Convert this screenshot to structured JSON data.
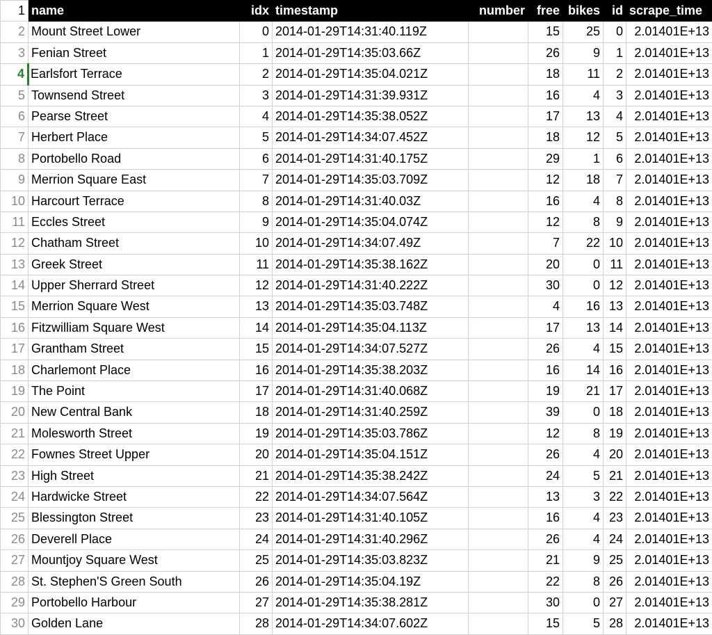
{
  "header": {
    "rownum": "1",
    "columns": {
      "name": "name",
      "idx": "idx",
      "timestamp": "timestamp",
      "number": "number",
      "free": "free",
      "bikes": "bikes",
      "id": "id",
      "scrape_time": "scrape_time"
    }
  },
  "selected_row": 4,
  "rows": [
    {
      "rownum": "2",
      "name": "Mount Street Lower",
      "idx": "0",
      "timestamp": "2014-01-29T14:31:40.119Z",
      "number": "",
      "free": "15",
      "bikes": "25",
      "id": "0",
      "scrape_time": "2.01401E+13"
    },
    {
      "rownum": "3",
      "name": "Fenian Street",
      "idx": "1",
      "timestamp": "2014-01-29T14:35:03.66Z",
      "number": "",
      "free": "26",
      "bikes": "9",
      "id": "1",
      "scrape_time": "2.01401E+13"
    },
    {
      "rownum": "4",
      "name": "Earlsfort Terrace",
      "idx": "2",
      "timestamp": "2014-01-29T14:35:04.021Z",
      "number": "",
      "free": "18",
      "bikes": "11",
      "id": "2",
      "scrape_time": "2.01401E+13"
    },
    {
      "rownum": "5",
      "name": "Townsend Street",
      "idx": "3",
      "timestamp": "2014-01-29T14:31:39.931Z",
      "number": "",
      "free": "16",
      "bikes": "4",
      "id": "3",
      "scrape_time": "2.01401E+13"
    },
    {
      "rownum": "6",
      "name": "Pearse Street",
      "idx": "4",
      "timestamp": "2014-01-29T14:35:38.052Z",
      "number": "",
      "free": "17",
      "bikes": "13",
      "id": "4",
      "scrape_time": "2.01401E+13"
    },
    {
      "rownum": "7",
      "name": "Herbert Place",
      "idx": "5",
      "timestamp": "2014-01-29T14:34:07.452Z",
      "number": "",
      "free": "18",
      "bikes": "12",
      "id": "5",
      "scrape_time": "2.01401E+13"
    },
    {
      "rownum": "8",
      "name": "Portobello Road",
      "idx": "6",
      "timestamp": "2014-01-29T14:31:40.175Z",
      "number": "",
      "free": "29",
      "bikes": "1",
      "id": "6",
      "scrape_time": "2.01401E+13"
    },
    {
      "rownum": "9",
      "name": "Merrion Square East",
      "idx": "7",
      "timestamp": "2014-01-29T14:35:03.709Z",
      "number": "",
      "free": "12",
      "bikes": "18",
      "id": "7",
      "scrape_time": "2.01401E+13"
    },
    {
      "rownum": "10",
      "name": "Harcourt Terrace",
      "idx": "8",
      "timestamp": "2014-01-29T14:31:40.03Z",
      "number": "",
      "free": "16",
      "bikes": "4",
      "id": "8",
      "scrape_time": "2.01401E+13"
    },
    {
      "rownum": "11",
      "name": "Eccles Street",
      "idx": "9",
      "timestamp": "2014-01-29T14:35:04.074Z",
      "number": "",
      "free": "12",
      "bikes": "8",
      "id": "9",
      "scrape_time": "2.01401E+13"
    },
    {
      "rownum": "12",
      "name": "Chatham Street",
      "idx": "10",
      "timestamp": "2014-01-29T14:34:07.49Z",
      "number": "",
      "free": "7",
      "bikes": "22",
      "id": "10",
      "scrape_time": "2.01401E+13"
    },
    {
      "rownum": "13",
      "name": "Greek Street",
      "idx": "11",
      "timestamp": "2014-01-29T14:35:38.162Z",
      "number": "",
      "free": "20",
      "bikes": "0",
      "id": "11",
      "scrape_time": "2.01401E+13"
    },
    {
      "rownum": "14",
      "name": "Upper Sherrard Street",
      "idx": "12",
      "timestamp": "2014-01-29T14:31:40.222Z",
      "number": "",
      "free": "30",
      "bikes": "0",
      "id": "12",
      "scrape_time": "2.01401E+13"
    },
    {
      "rownum": "15",
      "name": "Merrion Square West",
      "idx": "13",
      "timestamp": "2014-01-29T14:35:03.748Z",
      "number": "",
      "free": "4",
      "bikes": "16",
      "id": "13",
      "scrape_time": "2.01401E+13"
    },
    {
      "rownum": "16",
      "name": "Fitzwilliam Square West",
      "idx": "14",
      "timestamp": "2014-01-29T14:35:04.113Z",
      "number": "",
      "free": "17",
      "bikes": "13",
      "id": "14",
      "scrape_time": "2.01401E+13"
    },
    {
      "rownum": "17",
      "name": "Grantham Street",
      "idx": "15",
      "timestamp": "2014-01-29T14:34:07.527Z",
      "number": "",
      "free": "26",
      "bikes": "4",
      "id": "15",
      "scrape_time": "2.01401E+13"
    },
    {
      "rownum": "18",
      "name": "Charlemont Place",
      "idx": "16",
      "timestamp": "2014-01-29T14:35:38.203Z",
      "number": "",
      "free": "16",
      "bikes": "14",
      "id": "16",
      "scrape_time": "2.01401E+13"
    },
    {
      "rownum": "19",
      "name": "The Point",
      "idx": "17",
      "timestamp": "2014-01-29T14:31:40.068Z",
      "number": "",
      "free": "19",
      "bikes": "21",
      "id": "17",
      "scrape_time": "2.01401E+13"
    },
    {
      "rownum": "20",
      "name": "New Central Bank",
      "idx": "18",
      "timestamp": "2014-01-29T14:31:40.259Z",
      "number": "",
      "free": "39",
      "bikes": "0",
      "id": "18",
      "scrape_time": "2.01401E+13"
    },
    {
      "rownum": "21",
      "name": "Molesworth Street",
      "idx": "19",
      "timestamp": "2014-01-29T14:35:03.786Z",
      "number": "",
      "free": "12",
      "bikes": "8",
      "id": "19",
      "scrape_time": "2.01401E+13"
    },
    {
      "rownum": "22",
      "name": "Fownes Street Upper",
      "idx": "20",
      "timestamp": "2014-01-29T14:35:04.151Z",
      "number": "",
      "free": "26",
      "bikes": "4",
      "id": "20",
      "scrape_time": "2.01401E+13"
    },
    {
      "rownum": "23",
      "name": "High Street",
      "idx": "21",
      "timestamp": "2014-01-29T14:35:38.242Z",
      "number": "",
      "free": "24",
      "bikes": "5",
      "id": "21",
      "scrape_time": "2.01401E+13"
    },
    {
      "rownum": "24",
      "name": "Hardwicke Street",
      "idx": "22",
      "timestamp": "2014-01-29T14:34:07.564Z",
      "number": "",
      "free": "13",
      "bikes": "3",
      "id": "22",
      "scrape_time": "2.01401E+13"
    },
    {
      "rownum": "25",
      "name": "Blessington Street",
      "idx": "23",
      "timestamp": "2014-01-29T14:31:40.105Z",
      "number": "",
      "free": "16",
      "bikes": "4",
      "id": "23",
      "scrape_time": "2.01401E+13"
    },
    {
      "rownum": "26",
      "name": "Deverell Place",
      "idx": "24",
      "timestamp": "2014-01-29T14:31:40.296Z",
      "number": "",
      "free": "26",
      "bikes": "4",
      "id": "24",
      "scrape_time": "2.01401E+13"
    },
    {
      "rownum": "27",
      "name": "Mountjoy Square West",
      "idx": "25",
      "timestamp": "2014-01-29T14:35:03.823Z",
      "number": "",
      "free": "21",
      "bikes": "9",
      "id": "25",
      "scrape_time": "2.01401E+13"
    },
    {
      "rownum": "28",
      "name": "St. Stephen'S Green South",
      "idx": "26",
      "timestamp": "2014-01-29T14:35:04.19Z",
      "number": "",
      "free": "22",
      "bikes": "8",
      "id": "26",
      "scrape_time": "2.01401E+13"
    },
    {
      "rownum": "29",
      "name": "Portobello Harbour",
      "idx": "27",
      "timestamp": "2014-01-29T14:35:38.281Z",
      "number": "",
      "free": "30",
      "bikes": "0",
      "id": "27",
      "scrape_time": "2.01401E+13"
    },
    {
      "rownum": "30",
      "name": "Golden Lane",
      "idx": "28",
      "timestamp": "2014-01-29T14:34:07.602Z",
      "number": "",
      "free": "15",
      "bikes": "5",
      "id": "28",
      "scrape_time": "2.01401E+13"
    }
  ]
}
